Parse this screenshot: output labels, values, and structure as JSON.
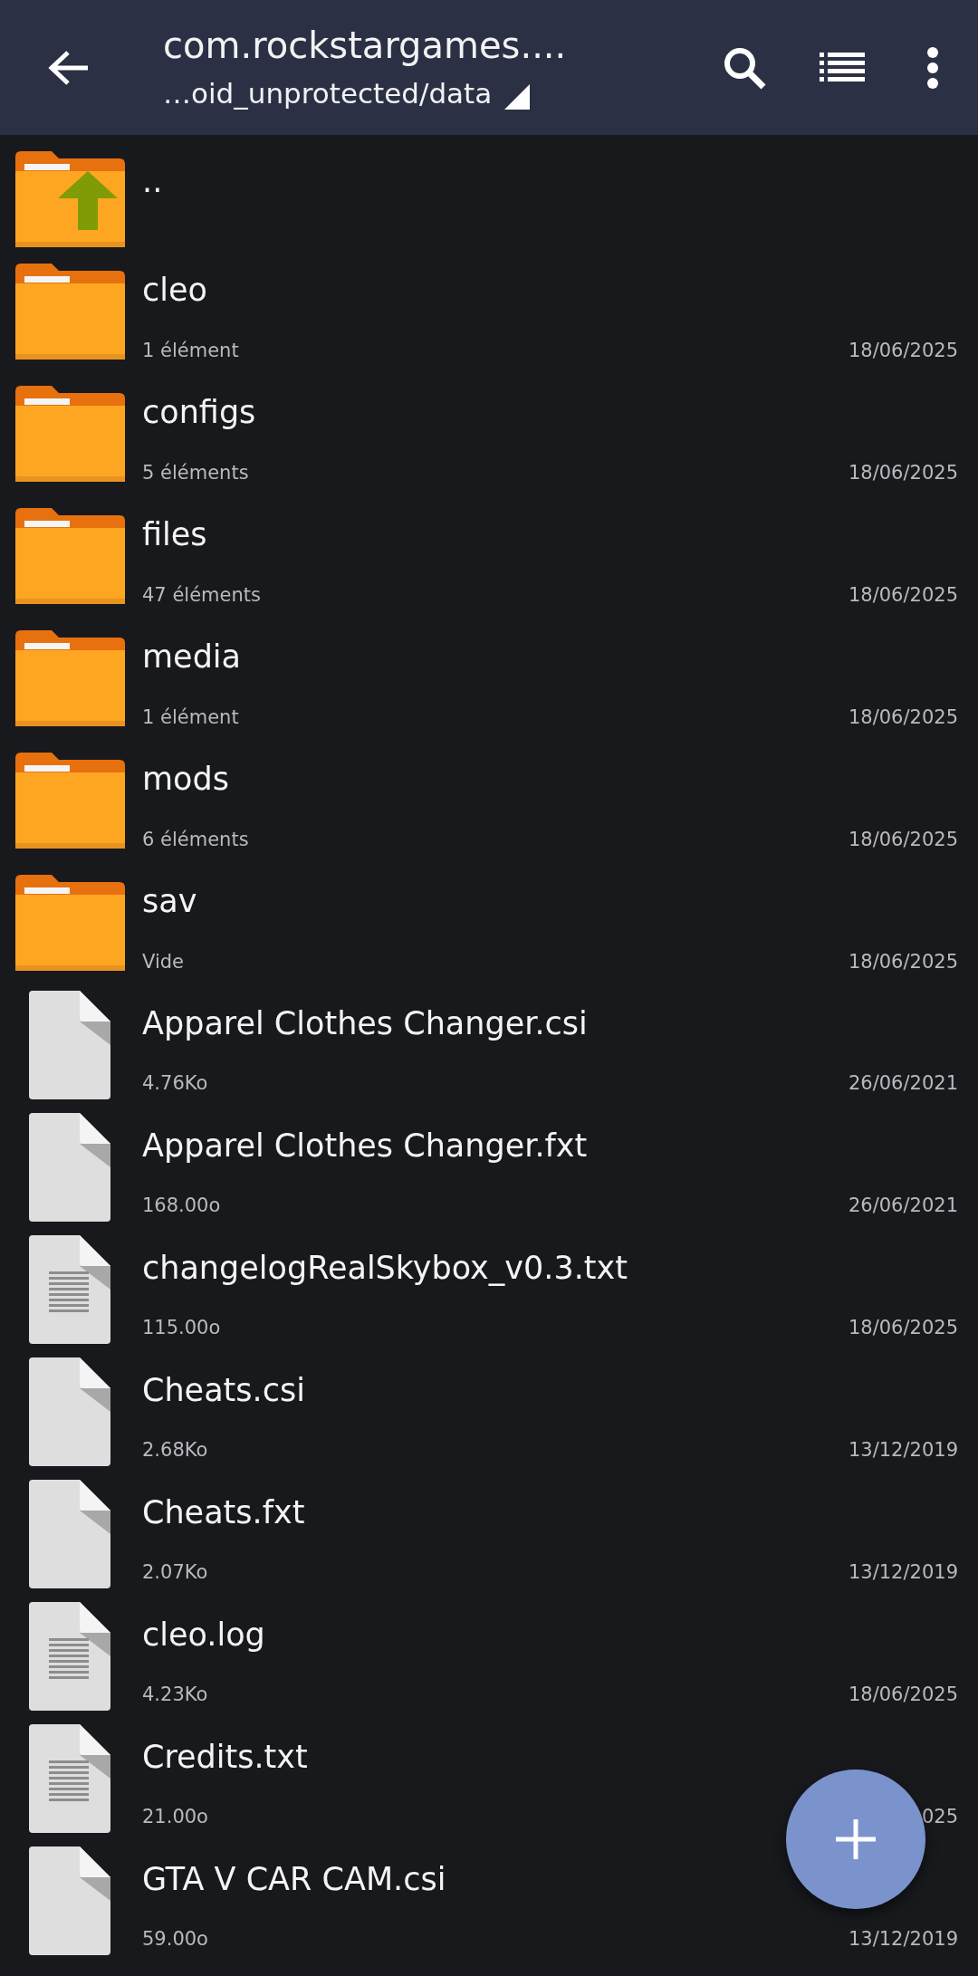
{
  "header": {
    "title": "com.rockstargames....",
    "path": "…oid_unprotected/data"
  },
  "items": [
    {
      "kind": "parent",
      "name": ".."
    },
    {
      "kind": "folder",
      "name": "cleo",
      "info": "1 élément",
      "date": "18/06/2025"
    },
    {
      "kind": "folder",
      "name": "configs",
      "info": "5 éléments",
      "date": "18/06/2025"
    },
    {
      "kind": "folder",
      "name": "files",
      "info": "47 éléments",
      "date": "18/06/2025"
    },
    {
      "kind": "folder",
      "name": "media",
      "info": "1 élément",
      "date": "18/06/2025"
    },
    {
      "kind": "folder",
      "name": "mods",
      "info": "6 éléments",
      "date": "18/06/2025"
    },
    {
      "kind": "folder",
      "name": "sav",
      "info": "Vide",
      "date": "18/06/2025"
    },
    {
      "kind": "file",
      "name": "Apparel Clothes Changer.csi",
      "info": "4.76Ko",
      "date": "26/06/2021"
    },
    {
      "kind": "file",
      "name": "Apparel Clothes Changer.fxt",
      "info": "168.00o",
      "date": "26/06/2021"
    },
    {
      "kind": "text-file",
      "name": "changelogRealSkybox_v0.3.txt",
      "info": "115.00o",
      "date": "18/06/2025"
    },
    {
      "kind": "file",
      "name": "Cheats.csi",
      "info": "2.68Ko",
      "date": "13/12/2019"
    },
    {
      "kind": "file",
      "name": "Cheats.fxt",
      "info": "2.07Ko",
      "date": "13/12/2019"
    },
    {
      "kind": "text-file",
      "name": "cleo.log",
      "info": "4.23Ko",
      "date": "18/06/2025"
    },
    {
      "kind": "text-file",
      "name": "Credits.txt",
      "info": "21.00o",
      "date": "025"
    },
    {
      "kind": "file",
      "name": "GTA V CAR CAM.csi",
      "info": "59.00o",
      "date": "13/12/2019"
    }
  ]
}
